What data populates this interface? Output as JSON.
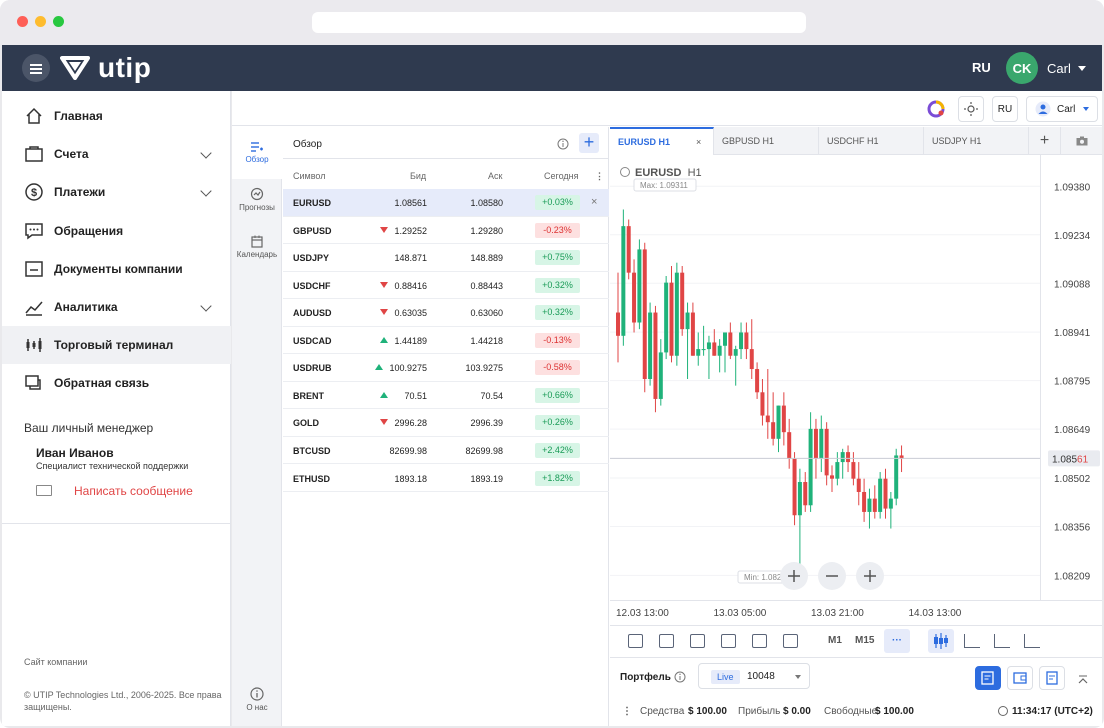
{
  "top": {
    "logo_text": "utip",
    "lang": "RU",
    "avatar_initials": "CK",
    "user": "Carl"
  },
  "sidebar": {
    "items": [
      {
        "label": "Главная",
        "icon": "home-icon"
      },
      {
        "label": "Счета",
        "icon": "wallet-icon",
        "expandable": true
      },
      {
        "label": "Платежи",
        "icon": "dollar-icon",
        "expandable": true
      },
      {
        "label": "Обращения",
        "icon": "chat-icon"
      },
      {
        "label": "Документы компании",
        "icon": "document-icon"
      },
      {
        "label": "Аналитика",
        "icon": "chart-icon",
        "expandable": true
      },
      {
        "label": "Торговый терминал",
        "icon": "terminal-icon",
        "active": true
      },
      {
        "label": "Обратная связь",
        "icon": "feedback-icon"
      }
    ],
    "manager_title": "Ваш личный менеджер",
    "manager_name": "Иван Иванов",
    "manager_role": "Специалист технической поддержки",
    "manager_msg": "Написать сообщение",
    "site_link": "Сайт компании",
    "copyright": "© UTIP Technologies Ltd., 2006-2025. Все права защищены."
  },
  "toolbar": {
    "lang": "RU",
    "user": "Carl"
  },
  "mini_side": {
    "overview": "Обзор",
    "forecasts": "Прогнозы",
    "calendar": "Календарь",
    "about": "О нас"
  },
  "watchlist": {
    "title": "Обзор",
    "cols": {
      "symbol": "Символ",
      "bid": "Бид",
      "ask": "Аск",
      "today": "Сегодня"
    },
    "rows": [
      {
        "sym": "EURUSD",
        "bid": "1.08561",
        "ask": "1.08580",
        "chg": "+0.03%",
        "dir": "",
        "pos": true,
        "selected": true
      },
      {
        "sym": "GBPUSD",
        "bid": "1.29252",
        "ask": "1.29280",
        "chg": "-0.23%",
        "dir": "down",
        "pos": false
      },
      {
        "sym": "USDJPY",
        "bid": "148.871",
        "ask": "148.889",
        "chg": "+0.75%",
        "dir": "",
        "pos": true
      },
      {
        "sym": "USDCHF",
        "bid": "0.88416",
        "ask": "0.88443",
        "chg": "+0.32%",
        "dir": "down",
        "pos": true
      },
      {
        "sym": "AUDUSD",
        "bid": "0.63035",
        "ask": "0.63060",
        "chg": "+0.32%",
        "dir": "down",
        "pos": true
      },
      {
        "sym": "USDCAD",
        "bid": "1.44189",
        "ask": "1.44218",
        "chg": "-0.13%",
        "dir": "up",
        "pos": false
      },
      {
        "sym": "USDRUB",
        "bid": "100.9275",
        "ask": "103.9275",
        "chg": "-0.58%",
        "dir": "up",
        "pos": false
      },
      {
        "sym": "BRENT",
        "bid": "70.51",
        "ask": "70.54",
        "chg": "+0.66%",
        "dir": "up",
        "pos": true
      },
      {
        "sym": "GOLD",
        "bid": "2996.28",
        "ask": "2996.39",
        "chg": "+0.26%",
        "dir": "down",
        "pos": true
      },
      {
        "sym": "BTCUSD",
        "bid": "82699.98",
        "ask": "82699.98",
        "chg": "+2.42%",
        "dir": "",
        "pos": true
      },
      {
        "sym": "ETHUSD",
        "bid": "1893.18",
        "ask": "1893.19",
        "chg": "+1.82%",
        "dir": "",
        "pos": true
      }
    ]
  },
  "chart_tabs": [
    "EURUSD H1",
    "GBPUSD H1",
    "USDCHF H1",
    "USDJPY H1"
  ],
  "chart_header": {
    "symbol": "EURUSD",
    "tf": "H1",
    "max": "Max: 1.09311",
    "min": "Min: 1.082"
  },
  "chart_data": {
    "type": "candlestick",
    "title": "EURUSD H1",
    "y_ticks": [
      "1.09380",
      "1.09234",
      "1.09088",
      "1.08941",
      "1.08795",
      "1.08649",
      "1.08502",
      "1.08356",
      "1.08209"
    ],
    "ylim": [
      1.0815,
      1.0945
    ],
    "x_ticks": [
      "12.03 13:00",
      "13.03 05:00",
      "13.03 21:00",
      "14.03 13:00"
    ],
    "current_price": "1.08561",
    "current_price_main": "1.085",
    "current_price_tail": "61",
    "current_value": 1.08561,
    "candles": [
      [
        1.09,
        1.0912,
        1.0885,
        1.0893
      ],
      [
        1.0893,
        1.0931,
        1.089,
        1.0926
      ],
      [
        1.0926,
        1.0928,
        1.091,
        1.0912
      ],
      [
        1.0912,
        1.0916,
        1.0894,
        1.0897
      ],
      [
        1.0897,
        1.0922,
        1.0895,
        1.0919
      ],
      [
        1.0919,
        1.0921,
        1.0876,
        1.088
      ],
      [
        1.088,
        1.0903,
        1.0878,
        1.09
      ],
      [
        1.09,
        1.0902,
        1.087,
        1.0874
      ],
      [
        1.0874,
        1.0892,
        1.0872,
        1.0888
      ],
      [
        1.0888,
        1.0911,
        1.0886,
        1.0909
      ],
      [
        1.0909,
        1.0914,
        1.0885,
        1.0887
      ],
      [
        1.0887,
        1.0915,
        1.0884,
        1.0912
      ],
      [
        1.0912,
        1.0914,
        1.0893,
        1.0895
      ],
      [
        1.0895,
        1.0903,
        1.088,
        1.09
      ],
      [
        1.09,
        1.0903,
        1.0887,
        1.0887
      ],
      [
        1.0887,
        1.0894,
        1.0884,
        1.0889
      ],
      [
        1.0889,
        1.0896,
        1.0887,
        1.0889
      ],
      [
        1.0889,
        1.0893,
        1.088,
        1.0891
      ],
      [
        1.0891,
        1.0895,
        1.0887,
        1.0887
      ],
      [
        1.0887,
        1.0892,
        1.0882,
        1.089
      ],
      [
        1.089,
        1.0894,
        1.0882,
        1.0894
      ],
      [
        1.0894,
        1.0897,
        1.0886,
        1.0887
      ],
      [
        1.0887,
        1.089,
        1.0878,
        1.0889
      ],
      [
        1.0889,
        1.0897,
        1.0886,
        1.0894
      ],
      [
        1.0894,
        1.0897,
        1.0886,
        1.0889
      ],
      [
        1.0889,
        1.0898,
        1.088,
        1.0883
      ],
      [
        1.0883,
        1.0885,
        1.0874,
        1.0876
      ],
      [
        1.0876,
        1.088,
        1.0866,
        1.0869
      ],
      [
        1.0869,
        1.0883,
        1.0862,
        1.0867
      ],
      [
        1.0867,
        1.0876,
        1.086,
        1.0862
      ],
      [
        1.0862,
        1.0872,
        1.0858,
        1.0872
      ],
      [
        1.0872,
        1.0876,
        1.086,
        1.0864
      ],
      [
        1.0864,
        1.0868,
        1.0853,
        1.0856
      ],
      [
        1.0856,
        1.0858,
        1.0836,
        1.0839
      ],
      [
        1.0839,
        1.0853,
        1.0822,
        1.0849
      ],
      [
        1.0849,
        1.0852,
        1.084,
        1.0842
      ],
      [
        1.0842,
        1.087,
        1.084,
        1.0865
      ],
      [
        1.0865,
        1.0868,
        1.085,
        1.0856
      ],
      [
        1.0856,
        1.0869,
        1.0852,
        1.0865
      ],
      [
        1.0865,
        1.0867,
        1.0848,
        1.0851
      ],
      [
        1.0851,
        1.0854,
        1.0846,
        1.085
      ],
      [
        1.085,
        1.0858,
        1.0848,
        1.0855
      ],
      [
        1.0855,
        1.0859,
        1.085,
        1.0858
      ],
      [
        1.0858,
        1.086,
        1.0852,
        1.0855
      ],
      [
        1.0855,
        1.0858,
        1.0848,
        1.085
      ],
      [
        1.085,
        1.0855,
        1.0842,
        1.0846
      ],
      [
        1.0846,
        1.085,
        1.0837,
        1.084
      ],
      [
        1.084,
        1.0847,
        1.0835,
        1.0844
      ],
      [
        1.0844,
        1.0848,
        1.0838,
        1.084
      ],
      [
        1.084,
        1.0852,
        1.0838,
        1.085
      ],
      [
        1.085,
        1.0853,
        1.0838,
        1.0841
      ],
      [
        1.0841,
        1.0846,
        1.0835,
        1.0844
      ],
      [
        1.0844,
        1.0859,
        1.0842,
        1.0857
      ],
      [
        1.0857,
        1.086,
        1.0852,
        1.0856
      ]
    ]
  },
  "chart_toolbar": {
    "m1": "M1",
    "m15": "M15",
    "more": "···"
  },
  "portfolio": {
    "title": "Портфель",
    "live": "Live",
    "account": "10048",
    "funds_label": "Средства",
    "funds": "$ 100.00",
    "profit_label": "Прибыль",
    "profit": "$ 0.00",
    "free_label": "Свободные",
    "free": "$ 100.00",
    "time": "11:34:17 (UTC+2)"
  },
  "colors": {
    "accent": "#2d6cdf",
    "bull": "#1fb27a",
    "bear": "#e04545",
    "nav": "#2f3a4f"
  }
}
